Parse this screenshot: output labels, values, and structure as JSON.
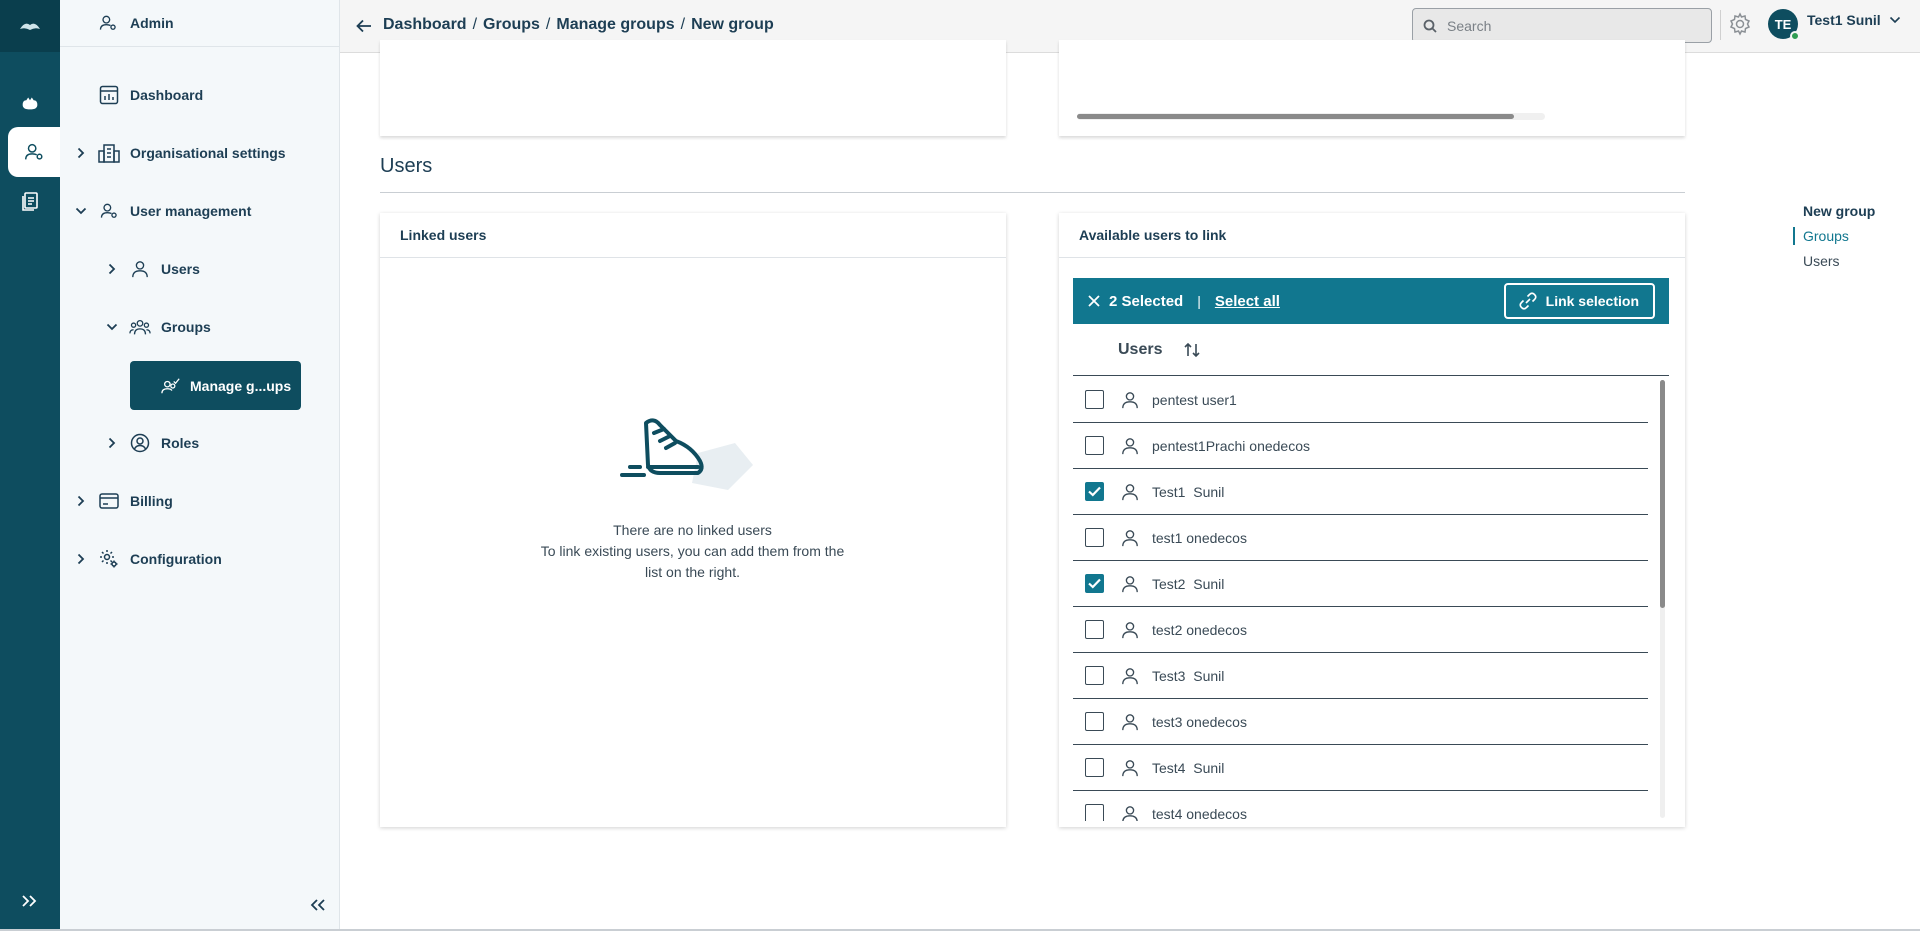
{
  "colors": {
    "primary_dark": "#0e4d5f",
    "accent_teal": "#11778f",
    "text_dark": "#1d3e54",
    "online_green": "#2e9c52"
  },
  "sidebar": {
    "title": "Admin",
    "items": [
      {
        "label": "Dashboard",
        "icon": "dashboard-icon"
      },
      {
        "label": "Organisational settings",
        "icon": "building-icon",
        "chevron": "right"
      },
      {
        "label": "User management",
        "icon": "user-settings-icon",
        "chevron": "down"
      },
      {
        "label": "Users",
        "icon": "user-icon",
        "chevron": "right"
      },
      {
        "label": "Groups",
        "icon": "group-icon",
        "chevron": "down"
      },
      {
        "label": "Manage g...ups",
        "icon": "manage-groups-icon",
        "active": true
      },
      {
        "label": "Roles",
        "icon": "role-icon",
        "chevron": "right"
      },
      {
        "label": "Billing",
        "icon": "billing-icon",
        "chevron": "right"
      },
      {
        "label": "Configuration",
        "icon": "configuration-icon",
        "chevron": "right"
      }
    ]
  },
  "header": {
    "breadcrumb": [
      "Dashboard",
      "Groups",
      "Manage groups",
      "New group"
    ],
    "breadcrumb_separator": "/",
    "search_placeholder": "Search",
    "avatar_initials": "TE",
    "user_name": "Test1 Sunil"
  },
  "users_section": {
    "title": "Users",
    "linked_panel": {
      "title": "Linked users",
      "empty_line1": "There are no linked users",
      "empty_line2": "To link existing users, you can add them from the",
      "empty_line3": "list on the right."
    },
    "available_panel": {
      "title": "Available users to link",
      "selected_count": "2 Selected",
      "separator": "|",
      "select_all": "Select all",
      "link_selection": "Link selection",
      "column_header": "Users",
      "rows": [
        {
          "name": "pentest user1",
          "checked": false
        },
        {
          "name": "pentest1Prachi onedecos",
          "checked": false
        },
        {
          "name": "Test1  Sunil",
          "checked": true
        },
        {
          "name": "test1 onedecos",
          "checked": false
        },
        {
          "name": "Test2  Sunil",
          "checked": true
        },
        {
          "name": "test2 onedecos",
          "checked": false
        },
        {
          "name": "Test3  Sunil",
          "checked": false
        },
        {
          "name": "test3 onedecos",
          "checked": false
        },
        {
          "name": "Test4  Sunil",
          "checked": false
        },
        {
          "name": "test4 onedecos",
          "checked": false
        }
      ]
    }
  },
  "toc": {
    "title": "New group",
    "items": [
      "Groups",
      "Users"
    ],
    "active": "Groups"
  }
}
